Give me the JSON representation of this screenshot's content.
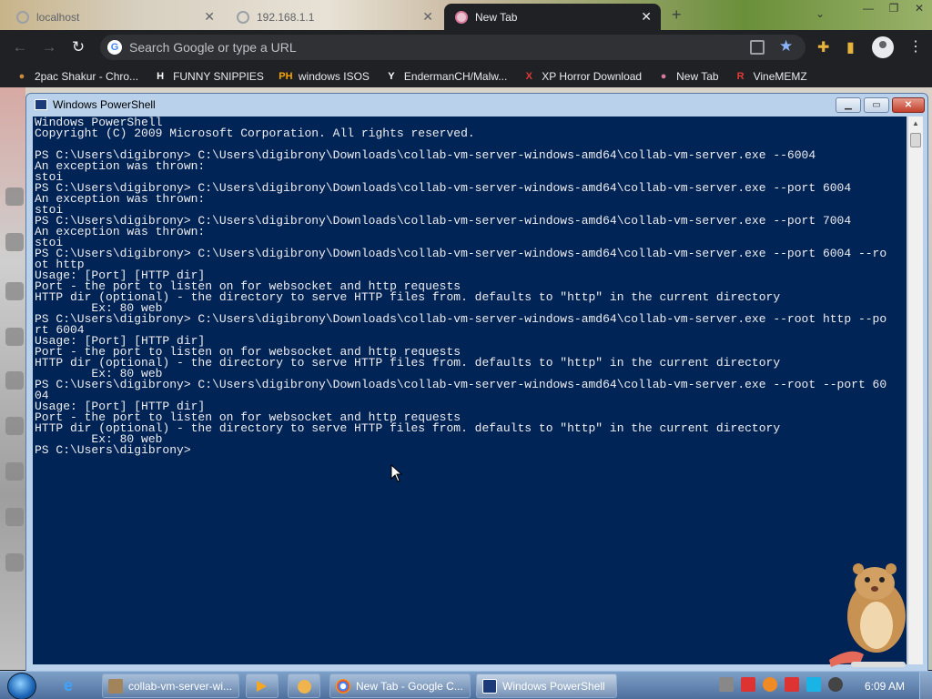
{
  "browser": {
    "tabs": [
      {
        "title": "localhost"
      },
      {
        "title": "192.168.1.1"
      },
      {
        "title": "New Tab"
      }
    ],
    "new_tab_symbol": "+",
    "close_symbol": "✕",
    "omnibox": {
      "placeholder": "Search Google or type a URL",
      "value": ""
    },
    "bookmarks": [
      {
        "label": "2pac Shakur - Chro...",
        "icon": "2pac-favicon",
        "color": "#c98a3c"
      },
      {
        "label": "FUNNY SNIPPIES",
        "icon": "H",
        "color": "#ffffff"
      },
      {
        "label": "windows ISOS",
        "icon": "PH",
        "color": "#f7a400"
      },
      {
        "label": "EndermanCH/Malw...",
        "icon": "Y",
        "color": "#ffffff"
      },
      {
        "label": "XP Horror Download",
        "icon": "X",
        "color": "#e53935"
      },
      {
        "label": "New Tab",
        "icon": "newtab-favicon",
        "color": "#d97a9a"
      },
      {
        "label": "VineMEMZ",
        "icon": "R",
        "color": "#e53935"
      }
    ]
  },
  "powershell": {
    "title": "Windows PowerShell",
    "console_lines": [
      "Windows PowerShell",
      "Copyright (C) 2009 Microsoft Corporation. All rights reserved.",
      "",
      "PS C:\\Users\\digibrony> C:\\Users\\digibrony\\Downloads\\collab-vm-server-windows-amd64\\collab-vm-server.exe --6004",
      "An exception was thrown:",
      "stoi",
      "PS C:\\Users\\digibrony> C:\\Users\\digibrony\\Downloads\\collab-vm-server-windows-amd64\\collab-vm-server.exe --port 6004",
      "An exception was thrown:",
      "stoi",
      "PS C:\\Users\\digibrony> C:\\Users\\digibrony\\Downloads\\collab-vm-server-windows-amd64\\collab-vm-server.exe --port 7004",
      "An exception was thrown:",
      "stoi",
      "PS C:\\Users\\digibrony> C:\\Users\\digibrony\\Downloads\\collab-vm-server-windows-amd64\\collab-vm-server.exe --port 6004 --ro",
      "ot http",
      "Usage: [Port] [HTTP dir]",
      "Port - the port to listen on for websocket and http requests",
      "HTTP dir (optional) - the directory to serve HTTP files from. defaults to \"http\" in the current directory",
      "        Ex: 80 web",
      "PS C:\\Users\\digibrony> C:\\Users\\digibrony\\Downloads\\collab-vm-server-windows-amd64\\collab-vm-server.exe --root http --po",
      "rt 6004",
      "Usage: [Port] [HTTP dir]",
      "Port - the port to listen on for websocket and http requests",
      "HTTP dir (optional) - the directory to serve HTTP files from. defaults to \"http\" in the current directory",
      "        Ex: 80 web",
      "PS C:\\Users\\digibrony> C:\\Users\\digibrony\\Downloads\\collab-vm-server-windows-amd64\\collab-vm-server.exe --root --port 60",
      "04",
      "Usage: [Port] [HTTP dir]",
      "Port - the port to listen on for websocket and http requests",
      "HTTP dir (optional) - the directory to serve HTTP files from. defaults to \"http\" in the current directory",
      "        Ex: 80 web",
      "PS C:\\Users\\digibrony>"
    ],
    "colors": {
      "background": "#012456",
      "text": "#eeedf0"
    }
  },
  "taskbar": {
    "buttons": [
      {
        "label": "collab-vm-server-wi..."
      },
      {
        "label": "New Tab - Google C..."
      },
      {
        "label": "Windows PowerShell"
      }
    ],
    "clock": "6:09 AM"
  }
}
